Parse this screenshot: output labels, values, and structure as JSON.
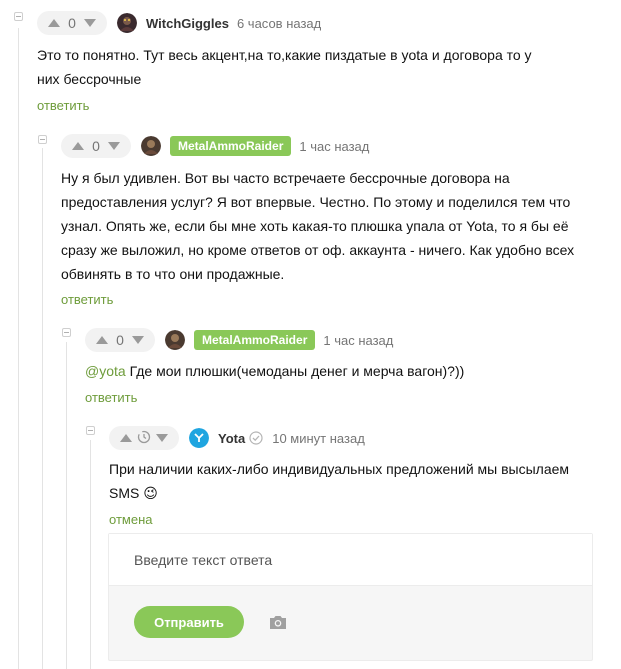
{
  "comments": [
    {
      "score": "0",
      "username": "WitchGiggles",
      "time": "6 часов назад",
      "text_lines": [
        "Это то понятно. Тут весь акцент,на то,какие пиздатые в yota и договора то у",
        "них бессрочные"
      ],
      "action": "ответить"
    },
    {
      "score": "0",
      "username": "MetalAmmoRaider",
      "time": "1 час назад",
      "text_lines": [
        "Ну я был удивлен. Вот вы часто встречаете бессрочные договора на",
        "предоставления услуг? Я вот впервые. Честно. По этому и поделился тем что",
        "узнал. Опять же, если бы мне хоть какая-то плюшка упала от Yota, то я бы её",
        "сразу же выложил, но кроме ответов от оф. аккаунта - ничего. Как удобно всех",
        "обвинять в то что они продажные."
      ],
      "action": "ответить"
    },
    {
      "score": "0",
      "username": "MetalAmmoRaider",
      "time": "1 час назад",
      "mention": "@yota",
      "text": " Где мои плюшки(чемоданы денег и мерча вагон)?))",
      "action": "ответить"
    },
    {
      "score_icon": "clock-icon",
      "username": "Yota",
      "time": "10 минут назад",
      "text_lines": [
        "При наличии каких-либо индивидуальных предложений мы высылаем",
        "SMS"
      ],
      "emoji": "😉",
      "action": "отмена"
    }
  ],
  "reply_form": {
    "placeholder": "Введите текст ответа",
    "submit_label": "Отправить",
    "attach_icon": "camera-icon"
  },
  "colors": {
    "accent": "#8ac858",
    "link": "#6e9c3b",
    "muted": "#757575"
  }
}
